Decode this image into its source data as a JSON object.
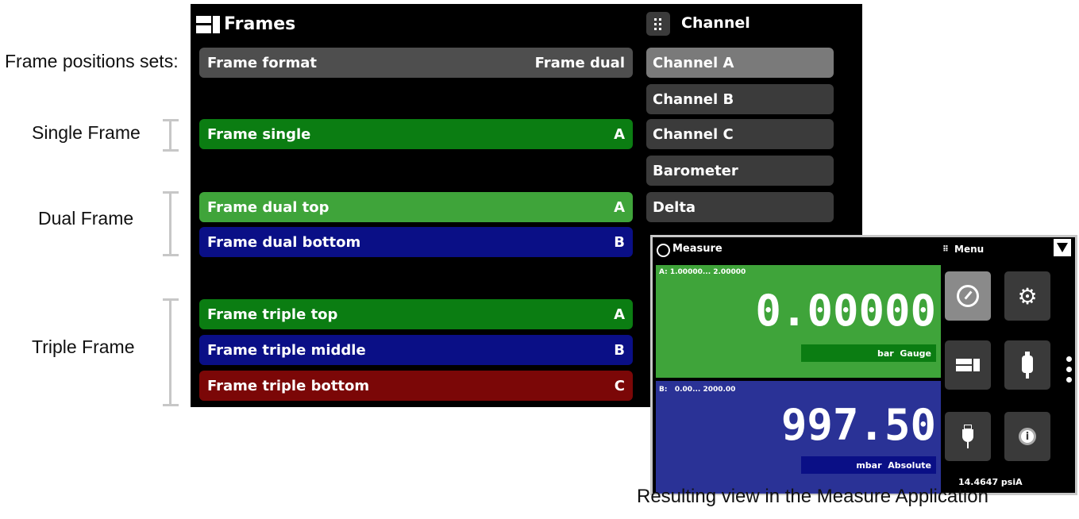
{
  "annotations": {
    "intro": "Frame positions sets:",
    "single": "Single Frame",
    "dual": "Dual Frame",
    "triple": "Triple Frame"
  },
  "frames": {
    "title": "Frames",
    "format_label": "Frame format",
    "format_value": "Frame dual",
    "rows": [
      {
        "label": "Frame single",
        "value": "A"
      },
      {
        "label": "Frame dual top",
        "value": "A"
      },
      {
        "label": "Frame dual bottom",
        "value": "B"
      },
      {
        "label": "Frame triple top",
        "value": "A"
      },
      {
        "label": "Frame triple middle",
        "value": "B"
      },
      {
        "label": "Frame triple bottom",
        "value": "C"
      }
    ]
  },
  "channel": {
    "title": "Channel",
    "items": [
      "Channel A",
      "Channel B",
      "Channel C",
      "Barometer",
      "Delta"
    ]
  },
  "measure": {
    "title": "Measure",
    "menu_label": "Menu",
    "channel_a": {
      "range": "A: 1.00000... 2.00000",
      "value": "0.00000",
      "unit": "bar",
      "mode": "Gauge"
    },
    "channel_b": {
      "range": "B:   0.00... 2000.00",
      "value": "997.50",
      "unit": "mbar",
      "mode": "Absolute"
    },
    "barometer_reading": "14.4647 psiA"
  },
  "caption": "Resulting view in the Measure Application",
  "colors": {
    "green_dark": "#0b7d12",
    "green_light": "#3fa43a",
    "blue": "#0a0f86",
    "red": "#7b0707",
    "gray_row": "#4e4e4e",
    "channel_selected": "#7a7a7a"
  }
}
